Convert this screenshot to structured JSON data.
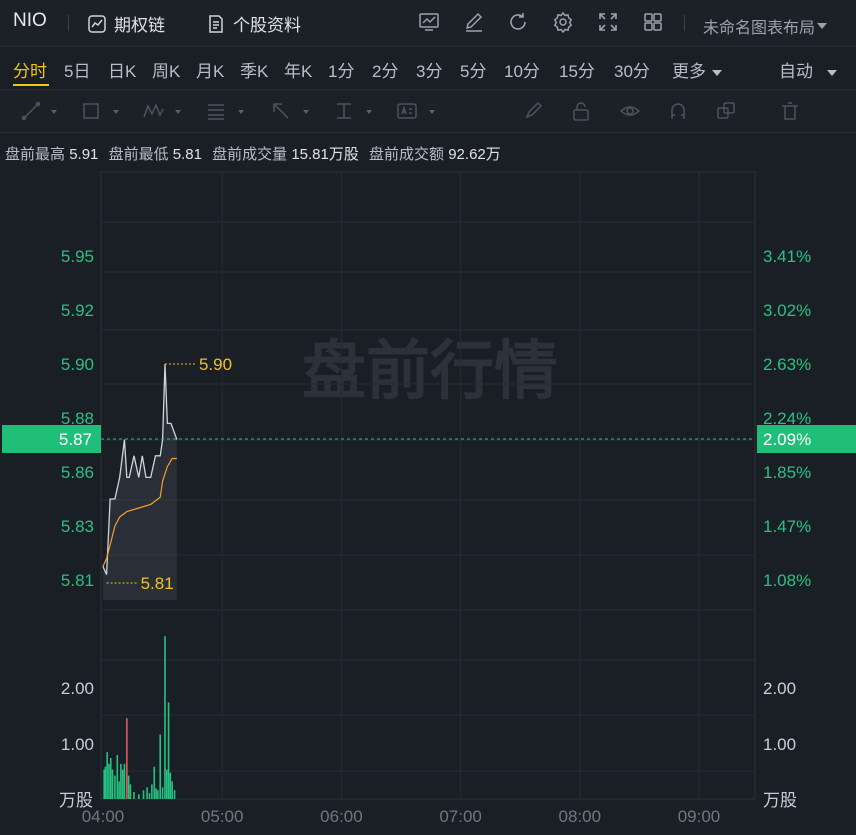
{
  "topbar": {
    "symbol": "NIO",
    "options_chain_label": "期权链",
    "stock_profile_label": "个股资料",
    "layout_name": "未命名图表布局"
  },
  "periods": [
    "分时",
    "5日",
    "日K",
    "周K",
    "月K",
    "季K",
    "年K",
    "1分",
    "2分",
    "3分",
    "5分",
    "10分",
    "15分",
    "30分",
    "更多"
  ],
  "active_period": "分时",
  "auto_label": "自动",
  "premarket": {
    "high_label": "盘前最高",
    "high_value": "5.91",
    "low_label": "盘前最低",
    "low_value": "5.81",
    "volume_label": "盘前成交量",
    "volume_value": "15.81万股",
    "amount_label": "盘前成交额",
    "amount_value": "92.62万"
  },
  "colors": {
    "up": "#26c281",
    "down": "#e05a5a",
    "accent": "#f0c419",
    "price_line": "#cfd3da",
    "avg_line": "#f0a030",
    "current_bg": "#1fbf7a"
  },
  "chart_data": {
    "type": "line",
    "watermark": "盘前行情",
    "price_ticks": [
      {
        "price": "5.95",
        "pct": "3.41%"
      },
      {
        "price": "5.92",
        "pct": "3.02%"
      },
      {
        "price": "5.90",
        "pct": "2.63%"
      },
      {
        "price": "5.88",
        "pct": "2.24%"
      },
      {
        "price": "5.86",
        "pct": "1.85%"
      },
      {
        "price": "5.83",
        "pct": "1.47%"
      },
      {
        "price": "5.81",
        "pct": "1.08%"
      }
    ],
    "current_price": "5.87",
    "current_pct": "2.09%",
    "max_label": "5.90",
    "min_label": "5.81",
    "volume_ticks": [
      "2.00",
      "1.00"
    ],
    "volume_unit": "万股",
    "time_ticks": [
      "04:00",
      "05:00",
      "06:00",
      "07:00",
      "08:00",
      "09:00"
    ],
    "price_range": [
      5.795,
      5.965
    ],
    "volume_range": [
      0,
      2.8
    ],
    "price_series": [
      [
        0,
        5.815
      ],
      [
        0.03,
        5.812
      ],
      [
        0.06,
        5.845
      ],
      [
        0.1,
        5.845
      ],
      [
        0.14,
        5.857
      ],
      [
        0.18,
        5.872
      ],
      [
        0.2,
        5.857
      ],
      [
        0.22,
        5.857
      ],
      [
        0.26,
        5.866
      ],
      [
        0.3,
        5.857
      ],
      [
        0.33,
        5.866
      ],
      [
        0.36,
        5.857
      ],
      [
        0.4,
        5.857
      ],
      [
        0.44,
        5.866
      ],
      [
        0.48,
        5.866
      ],
      [
        0.5,
        5.872
      ],
      [
        0.52,
        5.9
      ],
      [
        0.54,
        5.878
      ],
      [
        0.57,
        5.878
      ],
      [
        0.62,
        5.872
      ]
    ],
    "avg_series": [
      [
        0,
        5.815
      ],
      [
        0.03,
        5.818
      ],
      [
        0.06,
        5.823
      ],
      [
        0.1,
        5.83
      ],
      [
        0.14,
        5.835
      ],
      [
        0.2,
        5.838
      ],
      [
        0.3,
        5.84
      ],
      [
        0.4,
        5.842
      ],
      [
        0.48,
        5.846
      ],
      [
        0.5,
        5.855
      ],
      [
        0.54,
        5.862
      ],
      [
        0.58,
        5.865
      ],
      [
        0.62,
        5.865
      ]
    ],
    "volume_bars": [
      {
        "t": 0.01,
        "v": 0.5,
        "d": "up"
      },
      {
        "t": 0.02,
        "v": 0.55,
        "d": "up"
      },
      {
        "t": 0.035,
        "v": 0.8,
        "d": "up"
      },
      {
        "t": 0.05,
        "v": 0.6,
        "d": "up"
      },
      {
        "t": 0.065,
        "v": 0.7,
        "d": "up"
      },
      {
        "t": 0.08,
        "v": 0.5,
        "d": "up"
      },
      {
        "t": 0.1,
        "v": 0.4,
        "d": "up"
      },
      {
        "t": 0.12,
        "v": 0.75,
        "d": "up"
      },
      {
        "t": 0.135,
        "v": 0.3,
        "d": "up"
      },
      {
        "t": 0.15,
        "v": 0.6,
        "d": "up"
      },
      {
        "t": 0.165,
        "v": 0.5,
        "d": "up"
      },
      {
        "t": 0.18,
        "v": 0.6,
        "d": "up"
      },
      {
        "t": 0.2,
        "v": 1.38,
        "d": "down"
      },
      {
        "t": 0.215,
        "v": 0.4,
        "d": "up"
      },
      {
        "t": 0.23,
        "v": 0.25,
        "d": "up"
      },
      {
        "t": 0.26,
        "v": 0.12,
        "d": "up"
      },
      {
        "t": 0.3,
        "v": 0.08,
        "d": "up"
      },
      {
        "t": 0.34,
        "v": 0.15,
        "d": "up"
      },
      {
        "t": 0.37,
        "v": 0.2,
        "d": "up"
      },
      {
        "t": 0.39,
        "v": 0.1,
        "d": "up"
      },
      {
        "t": 0.41,
        "v": 0.25,
        "d": "up"
      },
      {
        "t": 0.43,
        "v": 0.55,
        "d": "up"
      },
      {
        "t": 0.445,
        "v": 0.18,
        "d": "up"
      },
      {
        "t": 0.46,
        "v": 0.15,
        "d": "up"
      },
      {
        "t": 0.48,
        "v": 1.1,
        "d": "up"
      },
      {
        "t": 0.5,
        "v": 0.2,
        "d": "up"
      },
      {
        "t": 0.52,
        "v": 2.78,
        "d": "up"
      },
      {
        "t": 0.535,
        "v": 0.5,
        "d": "up"
      },
      {
        "t": 0.55,
        "v": 1.65,
        "d": "up"
      },
      {
        "t": 0.565,
        "v": 0.45,
        "d": "up"
      },
      {
        "t": 0.58,
        "v": 0.3,
        "d": "up"
      },
      {
        "t": 0.6,
        "v": 0.15,
        "d": "up"
      }
    ]
  }
}
